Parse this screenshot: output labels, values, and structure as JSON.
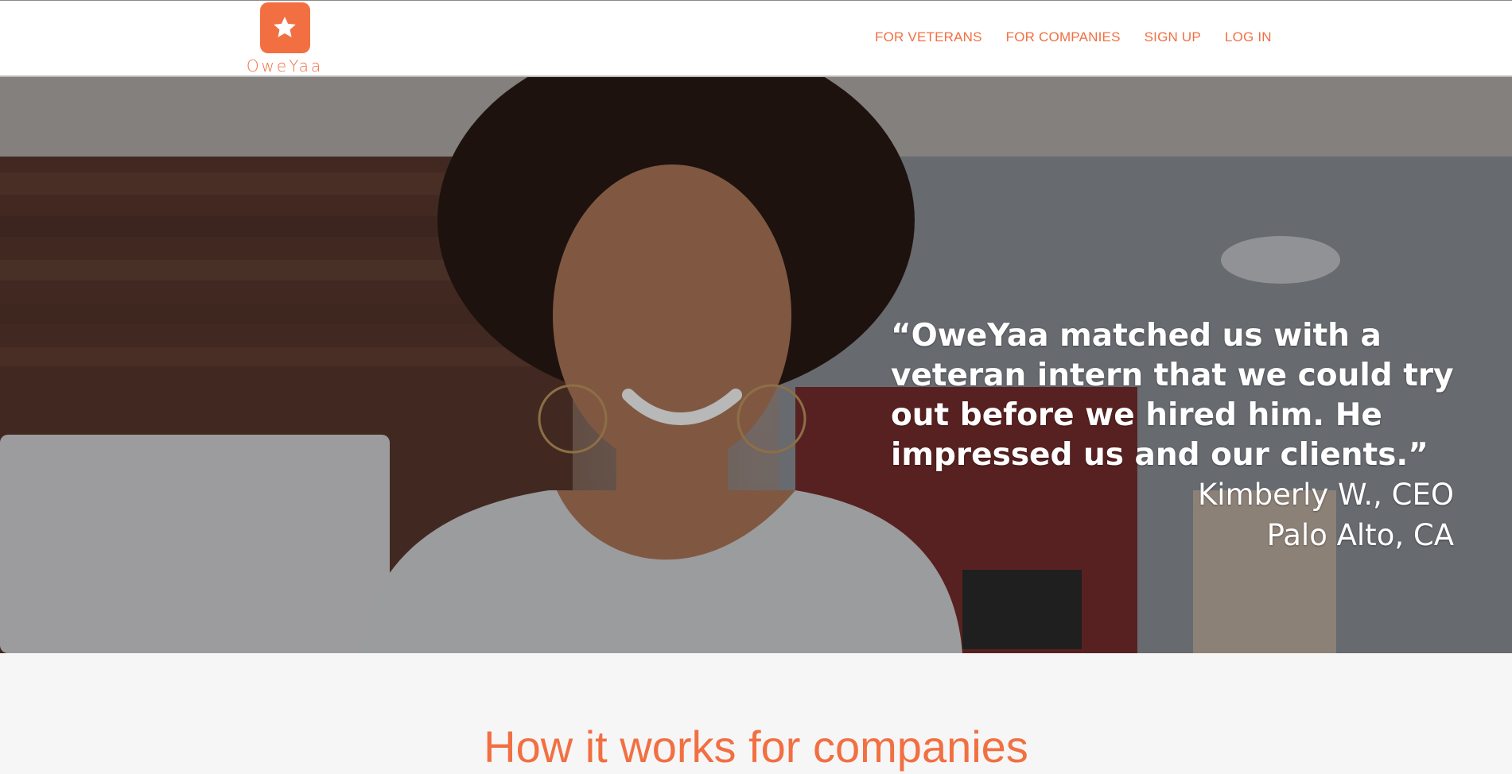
{
  "brand": {
    "name": "OweYaa",
    "accent_color": "#f26f42",
    "logo_icon": "star-icon"
  },
  "nav": {
    "items": [
      {
        "label": "FOR VETERANS"
      },
      {
        "label": "FOR COMPANIES"
      },
      {
        "label": "SIGN UP"
      },
      {
        "label": "LOG IN"
      }
    ]
  },
  "hero": {
    "quote": "“OweYaa matched us with a veteran intern that we could try out before we hired him. He impressed us and our clients.”",
    "attribution_name": "Kimberly W., CEO",
    "attribution_location": "Palo Alto, CA"
  },
  "section": {
    "title": "How it works for companies"
  }
}
